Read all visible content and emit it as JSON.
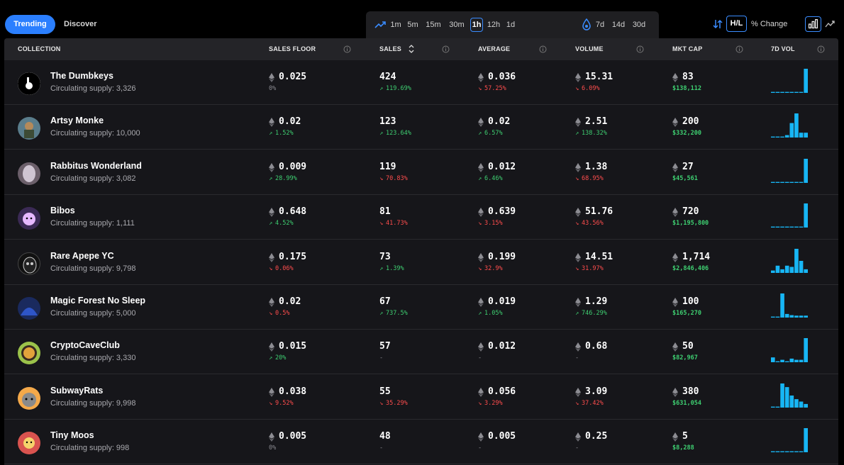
{
  "tabs": {
    "trending": "Trending",
    "discover": "Discover"
  },
  "timeframes": [
    "1m",
    "5m",
    "15m",
    "30m",
    "1h",
    "12h",
    "1d"
  ],
  "timeframes_long": [
    "7d",
    "14d",
    "30d"
  ],
  "active_timeframe": "1h",
  "view_toggle": {
    "hl": "H/L",
    "pct": "% Change"
  },
  "colors": {
    "accent": "#2b7fff",
    "up": "#3ecf71",
    "down": "#ff4d4d",
    "spark": "#17b6f5"
  },
  "columns": [
    "COLLECTION",
    "SALES FLOOR",
    "SALES",
    "AVERAGE",
    "VOLUME",
    "MKT CAP",
    "7D VOL"
  ],
  "rows": [
    {
      "name": "The Dumbkeys",
      "supply": "Circulating supply: 3,326",
      "floor": "0.025",
      "floor_chg": "0%",
      "floor_dir": "flat",
      "sales": "424",
      "sales_chg": "119.69%",
      "sales_dir": "up",
      "avg": "0.036",
      "avg_chg": "57.25%",
      "avg_dir": "down",
      "vol": "15.31",
      "vol_chg": "6.09%",
      "vol_dir": "down",
      "mcap": "83",
      "mcap_usd": "$138,112",
      "spark": [
        0.04,
        0.04,
        0.04,
        0.04,
        0.04,
        0.04,
        0.04,
        1.0
      ]
    },
    {
      "name": "Artsy Monke",
      "supply": "Circulating supply: 10,000",
      "floor": "0.02",
      "floor_chg": "1.52%",
      "floor_dir": "up",
      "sales": "123",
      "sales_chg": "123.64%",
      "sales_dir": "up",
      "avg": "0.02",
      "avg_chg": "6.57%",
      "avg_dir": "up",
      "vol": "2.51",
      "vol_chg": "138.32%",
      "vol_dir": "up",
      "mcap": "200",
      "mcap_usd": "$332,200",
      "spark": [
        0.04,
        0.04,
        0.04,
        0.1,
        0.6,
        1.0,
        0.2,
        0.2
      ]
    },
    {
      "name": "Rabbitus Wonderland",
      "supply": "Circulating supply: 3,082",
      "floor": "0.009",
      "floor_chg": "28.99%",
      "floor_dir": "up",
      "sales": "119",
      "sales_chg": "70.83%",
      "sales_dir": "down",
      "avg": "0.012",
      "avg_chg": "6.46%",
      "avg_dir": "up",
      "vol": "1.38",
      "vol_chg": "68.95%",
      "vol_dir": "down",
      "mcap": "27",
      "mcap_usd": "$45,561",
      "spark": [
        0.04,
        0.04,
        0.04,
        0.04,
        0.04,
        0.04,
        0.04,
        1.0
      ]
    },
    {
      "name": "Bibos",
      "supply": "Circulating supply: 1,111",
      "floor": "0.648",
      "floor_chg": "4.52%",
      "floor_dir": "up",
      "sales": "81",
      "sales_chg": "41.73%",
      "sales_dir": "down",
      "avg": "0.639",
      "avg_chg": "3.15%",
      "avg_dir": "down",
      "vol": "51.76",
      "vol_chg": "43.56%",
      "vol_dir": "down",
      "mcap": "720",
      "mcap_usd": "$1,195,800",
      "spark": [
        0.04,
        0.04,
        0.04,
        0.04,
        0.04,
        0.04,
        0.04,
        1.0
      ]
    },
    {
      "name": "Rare Apepe YC",
      "supply": "Circulating supply: 9,798",
      "floor": "0.175",
      "floor_chg": "0.06%",
      "floor_dir": "down",
      "sales": "73",
      "sales_chg": "1.39%",
      "sales_dir": "up",
      "avg": "0.199",
      "avg_chg": "32.9%",
      "avg_dir": "down",
      "vol": "14.51",
      "vol_chg": "31.97%",
      "vol_dir": "down",
      "mcap": "1,714",
      "mcap_usd": "$2,846,406",
      "spark": [
        0.1,
        0.3,
        0.15,
        0.3,
        0.25,
        1.0,
        0.5,
        0.15
      ]
    },
    {
      "name": "Magic Forest No Sleep",
      "supply": "Circulating supply: 5,000",
      "floor": "0.02",
      "floor_chg": "0.5%",
      "floor_dir": "down",
      "sales": "67",
      "sales_chg": "737.5%",
      "sales_dir": "up",
      "avg": "0.019",
      "avg_chg": "1.05%",
      "avg_dir": "up",
      "vol": "1.29",
      "vol_chg": "746.29%",
      "vol_dir": "up",
      "mcap": "100",
      "mcap_usd": "$165,270",
      "spark": [
        0.04,
        0.04,
        1.0,
        0.15,
        0.1,
        0.08,
        0.08,
        0.08
      ]
    },
    {
      "name": "CryptoCaveClub",
      "supply": "Circulating supply: 3,330",
      "floor": "0.015",
      "floor_chg": "20%",
      "floor_dir": "up",
      "sales": "57",
      "sales_chg": "-",
      "sales_dir": "none",
      "avg": "0.012",
      "avg_chg": "-",
      "avg_dir": "none",
      "vol": "0.68",
      "vol_chg": "-",
      "vol_dir": "none",
      "mcap": "50",
      "mcap_usd": "$82,967",
      "spark": [
        0.2,
        0.04,
        0.1,
        0.04,
        0.15,
        0.1,
        0.1,
        1.0
      ]
    },
    {
      "name": "SubwayRats",
      "supply": "Circulating supply: 9,998",
      "floor": "0.038",
      "floor_chg": "9.52%",
      "floor_dir": "down",
      "sales": "55",
      "sales_chg": "35.29%",
      "sales_dir": "down",
      "avg": "0.056",
      "avg_chg": "3.29%",
      "avg_dir": "down",
      "vol": "3.09",
      "vol_chg": "37.42%",
      "vol_dir": "down",
      "mcap": "380",
      "mcap_usd": "$631,054",
      "spark": [
        0.04,
        0.04,
        1.0,
        0.85,
        0.5,
        0.35,
        0.25,
        0.15
      ]
    },
    {
      "name": "Tiny Moos",
      "supply": "Circulating supply: 998",
      "floor": "0.005",
      "floor_chg": "0%",
      "floor_dir": "flat",
      "sales": "48",
      "sales_chg": "-",
      "sales_dir": "none",
      "avg": "0.005",
      "avg_chg": "-",
      "avg_dir": "none",
      "vol": "0.25",
      "vol_chg": "-",
      "vol_dir": "none",
      "mcap": "5",
      "mcap_usd": "$8,288",
      "spark": [
        0.04,
        0.04,
        0.04,
        0.04,
        0.04,
        0.04,
        0.04,
        1.0
      ]
    }
  ]
}
